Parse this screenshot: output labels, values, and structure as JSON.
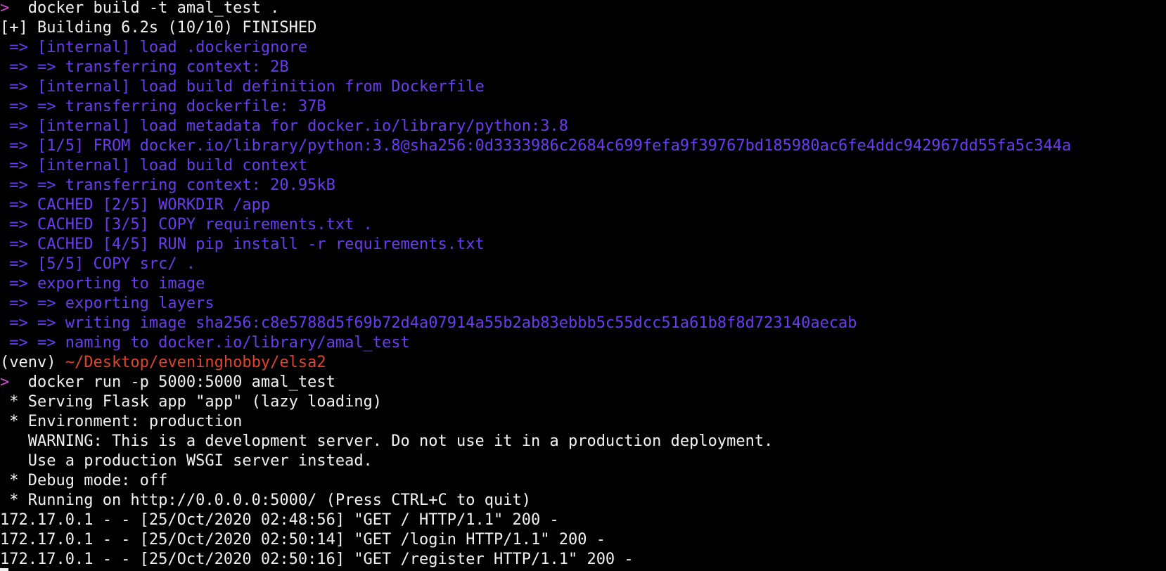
{
  "colors": {
    "background": "#000000",
    "text": "#f2f2f2",
    "prompt_arrow": "#d04bd6",
    "build_output": "#6a3cf0",
    "path": "#e0442c"
  },
  "terminal": {
    "lines": [
      {
        "segments": [
          {
            "text": ">",
            "style": "prompt-arrow"
          },
          {
            "text": "  docker build -t amal_test .",
            "style": "cmd"
          }
        ]
      },
      {
        "segments": [
          {
            "text": "[+] Building 6.2s (10/10) FINISHED",
            "style": "cmd"
          }
        ]
      },
      {
        "segments": [
          {
            "text": " => [internal] load .dockerignore",
            "style": "build"
          }
        ]
      },
      {
        "segments": [
          {
            "text": " => => transferring context: 2B",
            "style": "build"
          }
        ]
      },
      {
        "segments": [
          {
            "text": " => [internal] load build definition from Dockerfile",
            "style": "build"
          }
        ]
      },
      {
        "segments": [
          {
            "text": " => => transferring dockerfile: 37B",
            "style": "build"
          }
        ]
      },
      {
        "segments": [
          {
            "text": " => [internal] load metadata for docker.io/library/python:3.8",
            "style": "build"
          }
        ]
      },
      {
        "segments": [
          {
            "text": " => [1/5] FROM docker.io/library/python:3.8@sha256:0d3333986c2684c699fefa9f39767bd185980ac6fe4ddc942967dd55fa5c344a",
            "style": "build"
          }
        ]
      },
      {
        "segments": [
          {
            "text": " => [internal] load build context",
            "style": "build"
          }
        ]
      },
      {
        "segments": [
          {
            "text": " => => transferring context: 20.95kB",
            "style": "build"
          }
        ]
      },
      {
        "segments": [
          {
            "text": " => CACHED [2/5] WORKDIR /app",
            "style": "build"
          }
        ]
      },
      {
        "segments": [
          {
            "text": " => CACHED [3/5] COPY requirements.txt .",
            "style": "build"
          }
        ]
      },
      {
        "segments": [
          {
            "text": " => CACHED [4/5] RUN pip install -r requirements.txt",
            "style": "build"
          }
        ]
      },
      {
        "segments": [
          {
            "text": " => [5/5] COPY src/ .",
            "style": "build"
          }
        ]
      },
      {
        "segments": [
          {
            "text": " => exporting to image",
            "style": "build"
          }
        ]
      },
      {
        "segments": [
          {
            "text": " => => exporting layers",
            "style": "build"
          }
        ]
      },
      {
        "segments": [
          {
            "text": " => => writing image sha256:c8e5788d5f69b72d4a07914a55b2ab83ebbb5c55dcc51a61b8f8d723140aecab",
            "style": "build"
          }
        ]
      },
      {
        "segments": [
          {
            "text": " => => naming to docker.io/library/amal_test",
            "style": "build"
          }
        ]
      },
      {
        "segments": [
          {
            "text": "(venv) ",
            "style": "cmd"
          },
          {
            "text": "~/Desktop/eveninghobby/elsa2",
            "style": "path"
          }
        ]
      },
      {
        "segments": [
          {
            "text": ">",
            "style": "prompt-arrow"
          },
          {
            "text": "  docker run -p 5000:5000 amal_test",
            "style": "cmd"
          }
        ]
      },
      {
        "segments": [
          {
            "text": " * Serving Flask app \"app\" (lazy loading)",
            "style": "cmd"
          }
        ]
      },
      {
        "segments": [
          {
            "text": " * Environment: production",
            "style": "cmd"
          }
        ]
      },
      {
        "segments": [
          {
            "text": "   WARNING: This is a development server. Do not use it in a production deployment.",
            "style": "cmd"
          }
        ]
      },
      {
        "segments": [
          {
            "text": "   Use a production WSGI server instead.",
            "style": "cmd"
          }
        ]
      },
      {
        "segments": [
          {
            "text": " * Debug mode: off",
            "style": "cmd"
          }
        ]
      },
      {
        "segments": [
          {
            "text": " * Running on http://0.0.0.0:5000/ (Press CTRL+C to quit)",
            "style": "cmd"
          }
        ]
      },
      {
        "segments": [
          {
            "text": "172.17.0.1 - - [25/Oct/2020 02:48:56] \"GET / HTTP/1.1\" 200 -",
            "style": "cmd"
          }
        ]
      },
      {
        "segments": [
          {
            "text": "172.17.0.1 - - [25/Oct/2020 02:50:14] \"GET /login HTTP/1.1\" 200 -",
            "style": "cmd"
          }
        ]
      },
      {
        "segments": [
          {
            "text": "172.17.0.1 - - [25/Oct/2020 02:50:16] \"GET /register HTTP/1.1\" 200 -",
            "style": "cmd"
          }
        ]
      }
    ]
  }
}
